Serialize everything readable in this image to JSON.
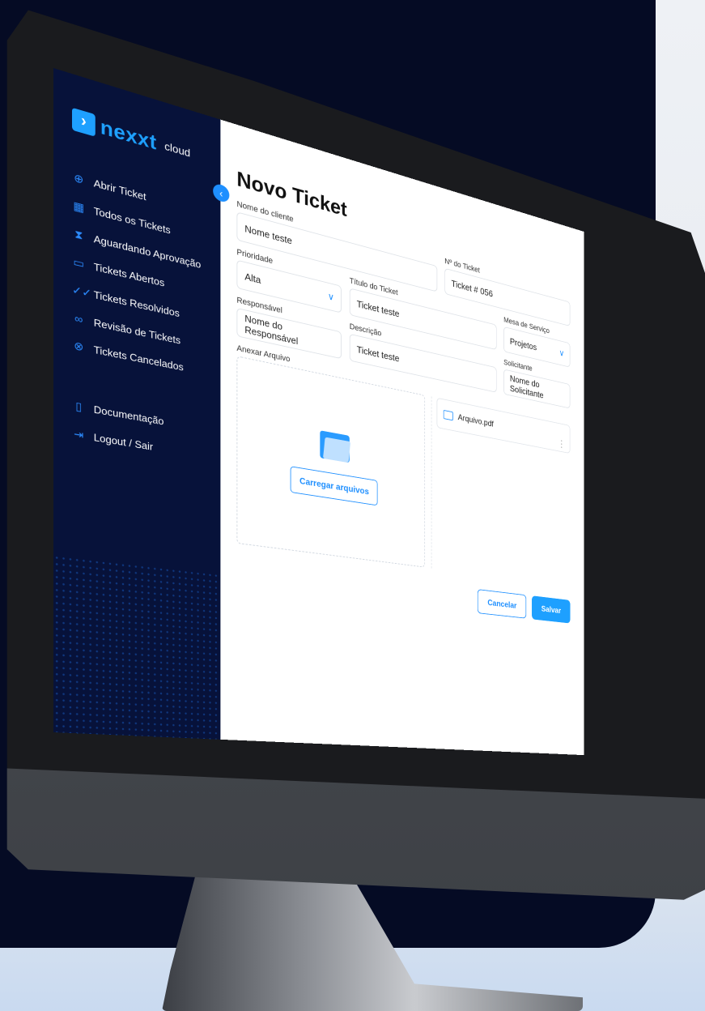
{
  "brand": {
    "mark": "›",
    "name": "nexxt",
    "suffix": "cloud"
  },
  "sidebar": {
    "items": [
      {
        "icon": "plus-circle-icon",
        "glyph": "⊕",
        "label": "Abrir Ticket"
      },
      {
        "icon": "grid-icon",
        "glyph": "▦",
        "label": "Todos os Tickets"
      },
      {
        "icon": "hourglass-icon",
        "glyph": "⧗",
        "label": "Aguardando Aprovação"
      },
      {
        "icon": "ticket-icon",
        "glyph": "▭",
        "label": "Tickets Abertos"
      },
      {
        "icon": "double-check-icon",
        "glyph": "✓✓",
        "label": "Tickets Resolvidos"
      },
      {
        "icon": "binoculars-icon",
        "glyph": "∞",
        "label": "Revisão de Tickets"
      },
      {
        "icon": "x-circle-icon",
        "glyph": "⊗",
        "label": "Tickets Cancelados"
      }
    ],
    "secondary": [
      {
        "icon": "document-icon",
        "glyph": "▯",
        "label": "Documentação"
      },
      {
        "icon": "logout-icon",
        "glyph": "⇥",
        "label": "Logout / Sair"
      }
    ]
  },
  "collapse": {
    "glyph": "‹"
  },
  "page": {
    "title": "Novo Ticket"
  },
  "form": {
    "client_label": "Nome do cliente",
    "client_value": "Nome teste",
    "ticket_no_label": "Nº do Ticket",
    "ticket_no_value": "Ticket # 056",
    "priority_label": "Prioridade",
    "priority_value": "Alta",
    "title_label": "Título do Ticket",
    "title_value": "Ticket teste",
    "service_label": "Mesa de Serviço",
    "service_value": "Projetos",
    "responsible_label": "Responsável",
    "responsible_value": "Nome do Responsável",
    "description_label": "Descrição",
    "description_value": "Ticket teste",
    "requester_label": "Solicitante",
    "requester_value": "Nome do Solicitante",
    "attach_label": "Anexar Arquivo",
    "upload_button": "Carregar arquivos",
    "file_name": "Arquivo.pdf",
    "chevron": "∨",
    "kebab": "⋮"
  },
  "actions": {
    "cancel": "Cancelar",
    "save": "Salvar"
  },
  "colors": {
    "accent": "#1ea0ff",
    "sidebar_bg": "#07123a",
    "page_bg": "#050b24"
  }
}
